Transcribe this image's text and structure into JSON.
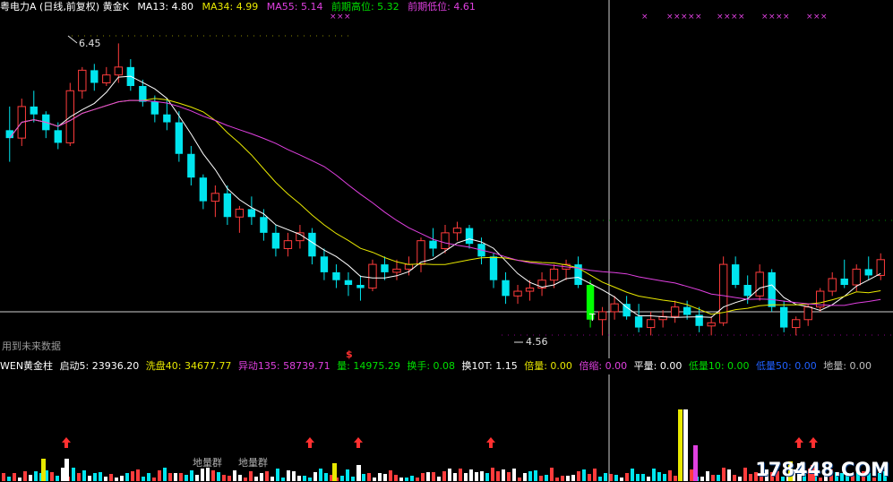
{
  "header": {
    "stock_title": "粤电力A (日线,前复权) 黄金K",
    "ma13": "MA13: 4.80",
    "ma34": "MA34: 4.99",
    "ma55": "MA55: 5.14",
    "prev_high": "前期高位: 5.32",
    "prev_low": "前期低位: 4.61"
  },
  "indicator_header": {
    "name": "WEN黄金柱",
    "start5": "启动5: 23936.20",
    "wash40": "洗盘40: 34677.77",
    "move135": "异动135: 58739.71",
    "volume": "量: 14975.29",
    "turnover": "换手: 0.08",
    "turnover10": "换10T: 1.15",
    "double_vol": "倍量: 0.00",
    "double_shrink": "倍缩: 0.00",
    "flat_vol": "平量: 0.00",
    "low_vol10": "低量10: 0.00",
    "low_vol50": "低量50: 0.00",
    "ground_vol": "地量: 0.00"
  },
  "labels": {
    "high_price": "6.45",
    "low_price": "4.56",
    "future_data": "用到未来数据",
    "ground_cluster_1": "地量群",
    "ground_cluster_2": "地量群",
    "t_marker": "T",
    "dollar_marker": "$",
    "watermark": "178448.COM"
  },
  "colors": {
    "up": "#ff3c3c",
    "down": "#00e5ee",
    "ma13": "#ffffff",
    "ma34": "#e8e800",
    "ma55": "#e040e0",
    "accent_green": "#00ff00"
  },
  "chart_data": {
    "type": "candlestick",
    "title": "粤电力A (日线,前复权) 黄金K",
    "ylim": [
      4.5,
      6.6
    ],
    "candles": [
      [
        5.9,
        6.05,
        5.7,
        5.85
      ],
      [
        5.85,
        6.1,
        5.8,
        6.05
      ],
      [
        6.05,
        6.15,
        5.95,
        6.0
      ],
      [
        6.0,
        6.02,
        5.85,
        5.9
      ],
      [
        5.9,
        5.95,
        5.78,
        5.82
      ],
      [
        5.82,
        6.2,
        5.8,
        6.15
      ],
      [
        6.15,
        6.3,
        6.1,
        6.28
      ],
      [
        6.28,
        6.32,
        6.15,
        6.2
      ],
      [
        6.2,
        6.3,
        6.18,
        6.25
      ],
      [
        6.25,
        6.45,
        6.2,
        6.3
      ],
      [
        6.3,
        6.35,
        6.15,
        6.18
      ],
      [
        6.18,
        6.22,
        6.05,
        6.08
      ],
      [
        6.08,
        6.12,
        5.95,
        6.0
      ],
      [
        6.0,
        6.1,
        5.9,
        5.95
      ],
      [
        5.95,
        6.02,
        5.7,
        5.75
      ],
      [
        5.75,
        5.8,
        5.55,
        5.6
      ],
      [
        5.6,
        5.62,
        5.4,
        5.45
      ],
      [
        5.45,
        5.55,
        5.35,
        5.5
      ],
      [
        5.5,
        5.55,
        5.3,
        5.35
      ],
      [
        5.35,
        5.42,
        5.25,
        5.4
      ],
      [
        5.4,
        5.48,
        5.3,
        5.35
      ],
      [
        5.35,
        5.4,
        5.2,
        5.25
      ],
      [
        5.25,
        5.3,
        5.1,
        5.15
      ],
      [
        5.15,
        5.25,
        5.1,
        5.2
      ],
      [
        5.2,
        5.3,
        5.15,
        5.25
      ],
      [
        5.25,
        5.28,
        5.05,
        5.1
      ],
      [
        5.1,
        5.15,
        4.95,
        5.0
      ],
      [
        5.0,
        5.05,
        4.9,
        4.95
      ],
      [
        4.95,
        5.0,
        4.85,
        4.92
      ],
      [
        4.92,
        4.98,
        4.82,
        4.9
      ],
      [
        4.9,
        5.08,
        4.88,
        5.05
      ],
      [
        5.05,
        5.1,
        4.95,
        5.0
      ],
      [
        5.0,
        5.08,
        4.95,
        5.02
      ],
      [
        5.02,
        5.1,
        4.98,
        5.05
      ],
      [
        5.05,
        5.22,
        5.0,
        5.2
      ],
      [
        5.2,
        5.28,
        5.1,
        5.15
      ],
      [
        5.15,
        5.3,
        5.12,
        5.25
      ],
      [
        5.25,
        5.32,
        5.2,
        5.28
      ],
      [
        5.28,
        5.3,
        5.15,
        5.18
      ],
      [
        5.18,
        5.22,
        5.05,
        5.1
      ],
      [
        5.1,
        5.12,
        4.9,
        4.95
      ],
      [
        4.95,
        5.0,
        4.8,
        4.85
      ],
      [
        4.85,
        4.92,
        4.8,
        4.88
      ],
      [
        4.88,
        4.95,
        4.82,
        4.9
      ],
      [
        4.9,
        5.0,
        4.85,
        4.95
      ],
      [
        4.95,
        5.05,
        4.9,
        5.02
      ],
      [
        5.02,
        5.08,
        4.95,
        5.05
      ],
      [
        5.05,
        5.1,
        4.9,
        4.92
      ],
      [
        4.92,
        4.95,
        4.65,
        4.7
      ],
      [
        4.7,
        4.78,
        4.6,
        4.75
      ],
      [
        4.75,
        4.85,
        4.7,
        4.8
      ],
      [
        4.8,
        4.85,
        4.7,
        4.72
      ],
      [
        4.72,
        4.8,
        4.62,
        4.65
      ],
      [
        4.65,
        4.75,
        4.6,
        4.7
      ],
      [
        4.7,
        4.76,
        4.65,
        4.72
      ],
      [
        4.72,
        4.82,
        4.68,
        4.78
      ],
      [
        4.78,
        4.82,
        4.7,
        4.73
      ],
      [
        4.73,
        4.78,
        4.62,
        4.66
      ],
      [
        4.66,
        4.72,
        4.6,
        4.68
      ],
      [
        4.68,
        5.1,
        4.66,
        5.05
      ],
      [
        5.05,
        5.1,
        4.9,
        4.92
      ],
      [
        4.92,
        4.98,
        4.8,
        4.85
      ],
      [
        4.85,
        5.05,
        4.82,
        5.0
      ],
      [
        5.0,
        5.02,
        4.75,
        4.78
      ],
      [
        4.78,
        4.82,
        4.62,
        4.65
      ],
      [
        4.65,
        4.72,
        4.6,
        4.7
      ],
      [
        4.7,
        4.8,
        4.66,
        4.78
      ],
      [
        4.78,
        4.9,
        4.75,
        4.88
      ],
      [
        4.88,
        5.0,
        4.85,
        4.96
      ],
      [
        4.96,
        5.08,
        4.9,
        4.92
      ],
      [
        4.92,
        5.05,
        4.88,
        5.02
      ],
      [
        5.02,
        5.1,
        4.95,
        4.98
      ],
      [
        4.98,
        5.12,
        4.95,
        5.08
      ]
    ]
  }
}
